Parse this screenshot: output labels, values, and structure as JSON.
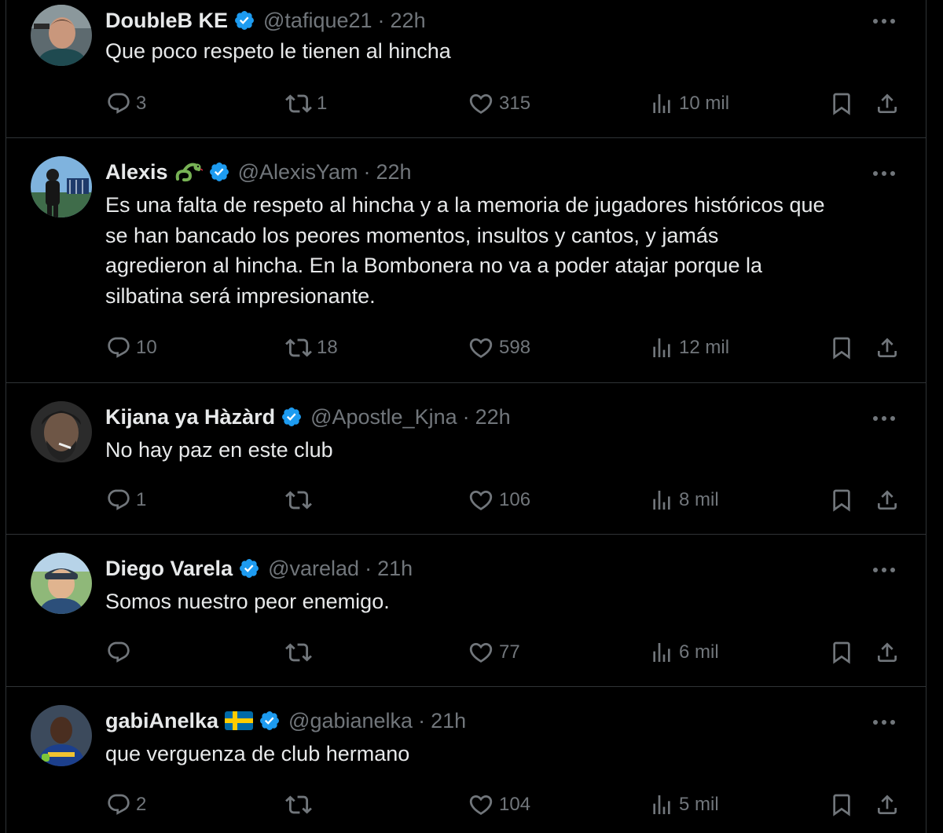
{
  "colors": {
    "background": "#000000",
    "text": "#e7e9ea",
    "secondary": "#71767b",
    "divider": "#2f3336",
    "verified": "#1d9bf0"
  },
  "tweets": [
    {
      "name": "DoubleB KE",
      "handle": "@tafique21",
      "separator": "·",
      "time": "22h",
      "text": "Que poco respeto le tienen al hincha",
      "replies": "3",
      "retweets": "1",
      "likes": "315",
      "views": "10 mil"
    },
    {
      "name": "Alexis",
      "emoji": "snake-emoji",
      "handle": "@AlexisYam",
      "separator": "·",
      "time": "22h",
      "text_lines": [
        "Es una falta de respeto al hincha y a la memoria de jugadores históricos que",
        "se han bancado los peores momentos, insultos y cantos, y jamás",
        "agredieron al hincha. En la Bombonera no va a poder atajar porque la",
        "silbatina será impresionante."
      ],
      "replies": "10",
      "retweets": "18",
      "likes": "598",
      "views": "12 mil"
    },
    {
      "name": "Kijana ya Hàzàrd",
      "handle": "@Apostle_Kjna",
      "separator": "·",
      "time": "22h",
      "text": "No hay paz en este club",
      "replies": "1",
      "retweets": "",
      "likes": "106",
      "views": "8 mil"
    },
    {
      "name": "Diego Varela",
      "handle": "@varelad",
      "separator": "·",
      "time": "21h",
      "text": "Somos nuestro peor enemigo.",
      "replies": "",
      "retweets": "",
      "likes": "77",
      "views": "6 mil"
    },
    {
      "name": "gabiAnelka",
      "emoji": "sweden-flag-emoji",
      "handle": "@gabianelka",
      "separator": "·",
      "time": "21h",
      "text": "que verguenza de club hermano",
      "replies": "2",
      "retweets": "",
      "likes": "104",
      "views": "5 mil"
    }
  ]
}
